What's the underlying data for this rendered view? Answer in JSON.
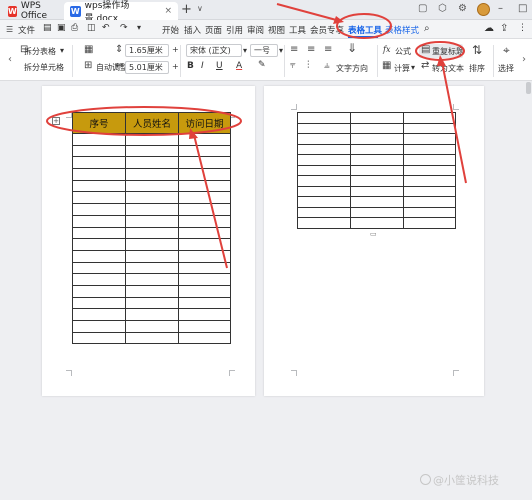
{
  "tabs": {
    "wps_label": "WPS Office",
    "doc_label": "wps操作场景.docx",
    "close_glyph": "×",
    "add_glyph": "+",
    "more_glyph": "∨"
  },
  "menu": {
    "file": "文件",
    "items": [
      "开始",
      "插入",
      "页面",
      "引用",
      "审阅",
      "视图",
      "工具",
      "会员专享",
      "表格工具",
      "表格样式"
    ],
    "active_index": 8,
    "accent_color": "#1764e8"
  },
  "ribbon": {
    "split_table": "拆分表格",
    "split_cell": "拆分单元格",
    "autofit": "自动调整",
    "row_height": "1.65厘米",
    "col_width": "5.01厘米",
    "font_name": "宋体 (正文)",
    "font_size": "一号",
    "text_direction": "文字方向",
    "formula": "公式",
    "calculate": "计算",
    "repeat_header": "重复标题",
    "convert_text": "转为文本",
    "sort": "排序",
    "select": "选择"
  },
  "table1": {
    "headers": [
      "序号",
      "人员姓名",
      "访问日期"
    ],
    "empty_rows": 18,
    "header_color": "#c79a0d"
  },
  "table2": {
    "rows": 11,
    "cols": 3
  },
  "annotation_color": "#e0413c",
  "watermark": "@小筐说科技"
}
